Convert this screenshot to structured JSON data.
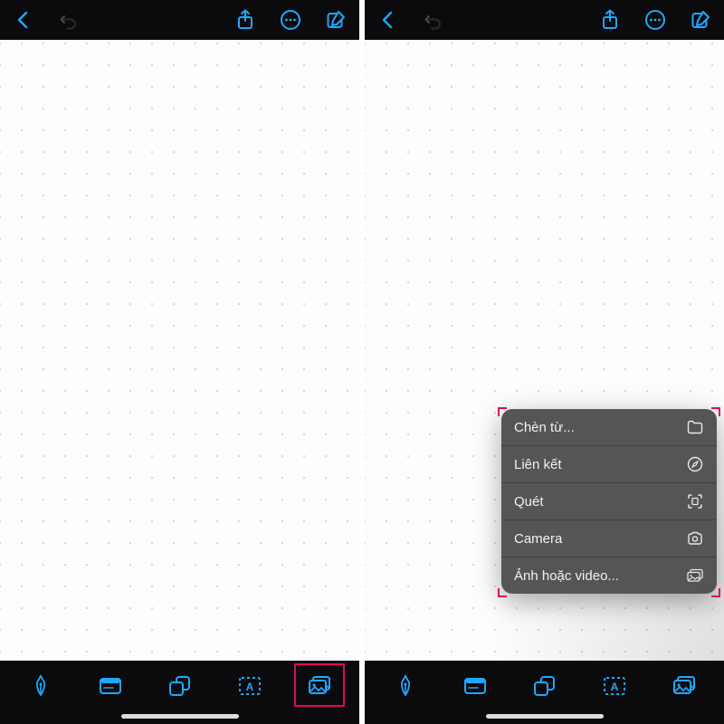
{
  "colors": {
    "accent": "#1ea8ff",
    "highlight": "#e3065d",
    "bar_bg": "#0b0b0d",
    "popup_bg": "rgba(78,78,80,0.96)"
  },
  "topbar": {
    "back_icon": "chevron-left",
    "undo_icon": "undo",
    "share_icon": "share",
    "more_icon": "ellipsis-circle",
    "compose_icon": "compose"
  },
  "bottombar": {
    "tools": [
      {
        "name": "pen-tool",
        "icon": "pen"
      },
      {
        "name": "card-tool",
        "icon": "card"
      },
      {
        "name": "shapes-tool",
        "icon": "shapes"
      },
      {
        "name": "text-tool",
        "icon": "text-a"
      },
      {
        "name": "image-tool",
        "icon": "image"
      }
    ]
  },
  "popup": {
    "items": [
      {
        "label": "Chèn từ...",
        "icon": "folder"
      },
      {
        "label": "Liên kết",
        "icon": "compass"
      },
      {
        "label": "Quét",
        "icon": "scan"
      },
      {
        "label": "Camera",
        "icon": "camera"
      },
      {
        "label": "Ảnh hoặc video...",
        "icon": "photo-stack"
      }
    ]
  }
}
